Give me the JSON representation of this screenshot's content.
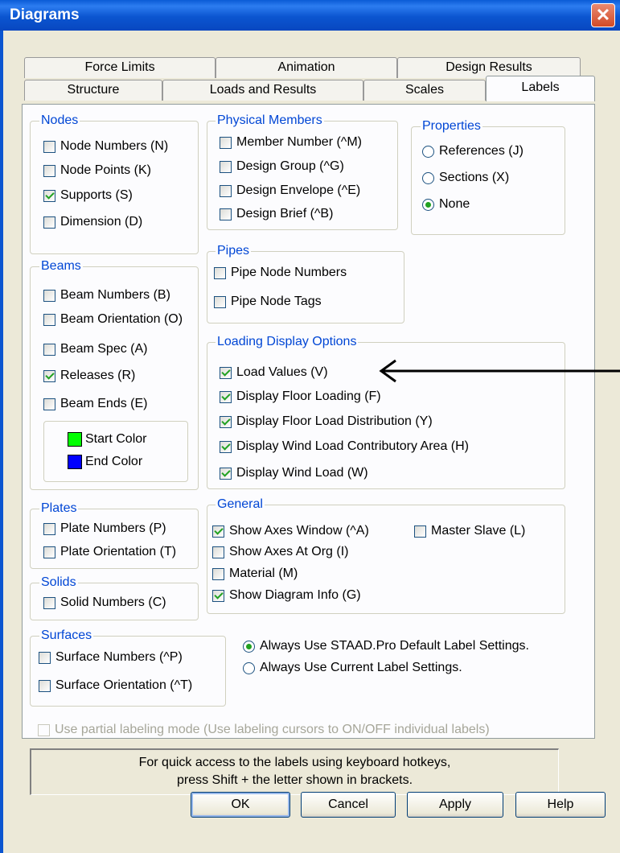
{
  "window": {
    "title": "Diagrams",
    "close_glyph": "✕"
  },
  "tabs_row1": [
    {
      "label": "Force Limits"
    },
    {
      "label": "Animation"
    },
    {
      "label": "Design Results"
    }
  ],
  "tabs_row2": [
    {
      "label": "Structure"
    },
    {
      "label": "Loads and Results"
    },
    {
      "label": "Scales"
    },
    {
      "label": "Labels",
      "active": true
    }
  ],
  "nodes": {
    "title": "Nodes",
    "items": [
      {
        "label": "Node Numbers (N)",
        "checked": false
      },
      {
        "label": "Node Points (K)",
        "checked": false
      },
      {
        "label": "Supports (S)",
        "checked": true
      },
      {
        "label": "Dimension (D)",
        "checked": false
      }
    ]
  },
  "physical_members": {
    "title": "Physical Members",
    "items": [
      {
        "label": "Member Number (^M)",
        "checked": false
      },
      {
        "label": "Design Group (^G)",
        "checked": false
      },
      {
        "label": "Design Envelope (^E)",
        "checked": false
      },
      {
        "label": "Design Brief (^B)",
        "checked": false
      }
    ]
  },
  "properties": {
    "title": "Properties",
    "options": [
      {
        "label": "References (J)",
        "selected": false
      },
      {
        "label": "Sections (X)",
        "selected": false
      },
      {
        "label": "None",
        "selected": true
      }
    ]
  },
  "beams": {
    "title": "Beams",
    "items": [
      {
        "label": "Beam Numbers (B)",
        "checked": false
      },
      {
        "label": "Beam Orientation (O)",
        "checked": false
      },
      {
        "label": "Beam Spec (A)",
        "checked": false
      },
      {
        "label": "Releases (R)",
        "checked": true
      },
      {
        "label": "Beam Ends (E)",
        "checked": false
      }
    ],
    "start_color": {
      "label": "Start Color",
      "color": "#00ff00"
    },
    "end_color": {
      "label": "End Color",
      "color": "#0000ff"
    }
  },
  "pipes": {
    "title": "Pipes",
    "items": [
      {
        "label": "Pipe Node Numbers",
        "checked": false
      },
      {
        "label": "Pipe Node Tags",
        "checked": false
      }
    ]
  },
  "loading": {
    "title": "Loading Display Options",
    "items": [
      {
        "label": "Load Values (V)",
        "checked": true
      },
      {
        "label": "Display Floor Loading (F)",
        "checked": true
      },
      {
        "label": "Display Floor Load Distribution (Y)",
        "checked": true
      },
      {
        "label": "Display Wind Load Contributory Area (H)",
        "checked": true
      },
      {
        "label": "Display Wind Load (W)",
        "checked": true
      }
    ]
  },
  "plates": {
    "title": "Plates",
    "items": [
      {
        "label": "Plate Numbers (P)",
        "checked": false
      },
      {
        "label": "Plate Orientation (T)",
        "checked": false
      }
    ]
  },
  "general": {
    "title": "General",
    "items": [
      {
        "label": "Show Axes Window (^A)",
        "checked": true
      },
      {
        "label": "Show Axes At Org (I)",
        "checked": false
      },
      {
        "label": "Material (M)",
        "checked": false
      },
      {
        "label": "Show Diagram Info (G)",
        "checked": true
      }
    ],
    "master_slave": {
      "label": "Master Slave (L)",
      "checked": false
    }
  },
  "solids": {
    "title": "Solids",
    "items": [
      {
        "label": "Solid Numbers (C)",
        "checked": false
      }
    ]
  },
  "surfaces": {
    "title": "Surfaces",
    "items": [
      {
        "label": "Surface Numbers (^P)",
        "checked": false
      },
      {
        "label": "Surface Orientation (^T)",
        "checked": false
      }
    ]
  },
  "label_settings": {
    "options": [
      {
        "label": "Always Use STAAD.Pro Default Label Settings.",
        "selected": true
      },
      {
        "label": "Always Use Current Label Settings.",
        "selected": false
      }
    ]
  },
  "partial_mode": {
    "label": "Use partial labeling mode (Use labeling cursors to ON/OFF individual labels)",
    "checked": false,
    "enabled": false
  },
  "hint": {
    "line1": "For quick access to the labels using keyboard hotkeys,",
    "line2": "press Shift + the letter shown in brackets."
  },
  "buttons": {
    "ok": "OK",
    "cancel": "Cancel",
    "apply": "Apply",
    "help": "Help"
  }
}
